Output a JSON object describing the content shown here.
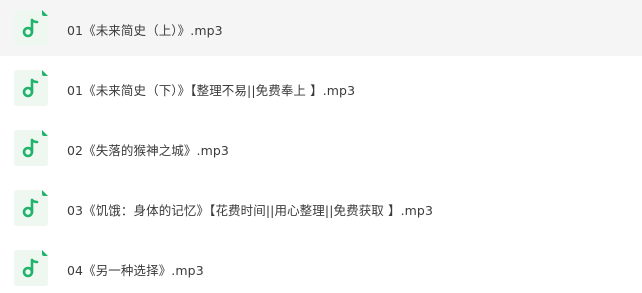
{
  "files": [
    {
      "name": "01《未来简史（上）》.mp3",
      "icon": "audio-file-icon",
      "selected": true
    },
    {
      "name": "01《未来简史（下）》【整理不易||免费奉上 】.mp3",
      "icon": "audio-file-icon",
      "selected": false
    },
    {
      "name": "02《失落的猴神之城》.mp3",
      "icon": "audio-file-icon",
      "selected": false
    },
    {
      "name": "03《饥饿：身体的记忆》【花费时间||用心整理||免费获取 】.mp3",
      "icon": "audio-file-icon",
      "selected": false
    },
    {
      "name": "04《另一种选择》.mp3",
      "icon": "audio-file-icon",
      "selected": false
    }
  ],
  "colors": {
    "accent": "#20b36a",
    "icon_background": "#eef8f1",
    "selected_row": "#f5f5f6",
    "text": "#3b3b3b"
  }
}
